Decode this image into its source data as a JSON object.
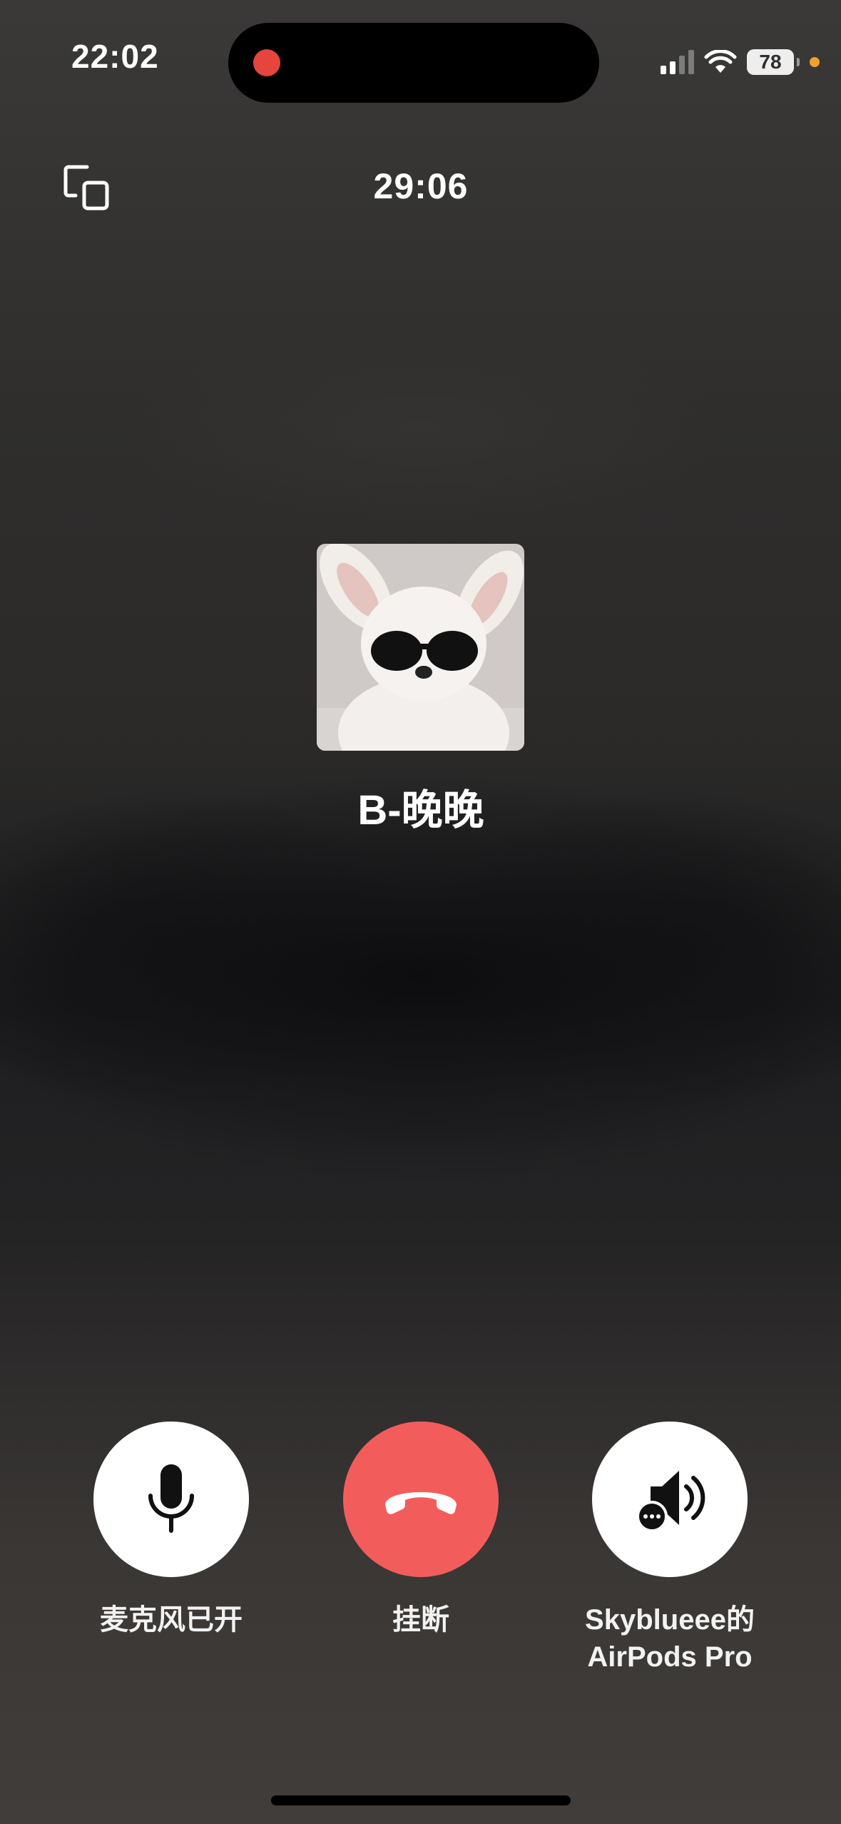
{
  "status_bar": {
    "time": "22:02",
    "battery": "78"
  },
  "call": {
    "timer": "29:06",
    "contact_name": "B-晚晚"
  },
  "controls": {
    "mic_label": "麦克风已开",
    "hangup_label": "挂断",
    "audio_label": "Skyblueee的\nAirPods Pro"
  },
  "colors": {
    "hangup_red": "#f25d5b",
    "recording_red": "#e5453c",
    "privacy_orange": "#f3a02c"
  },
  "icons": {
    "pip": "picture-in-picture-icon",
    "mic": "microphone-icon",
    "hangup": "phone-hangup-icon",
    "audio": "speaker-airpods-icon"
  }
}
